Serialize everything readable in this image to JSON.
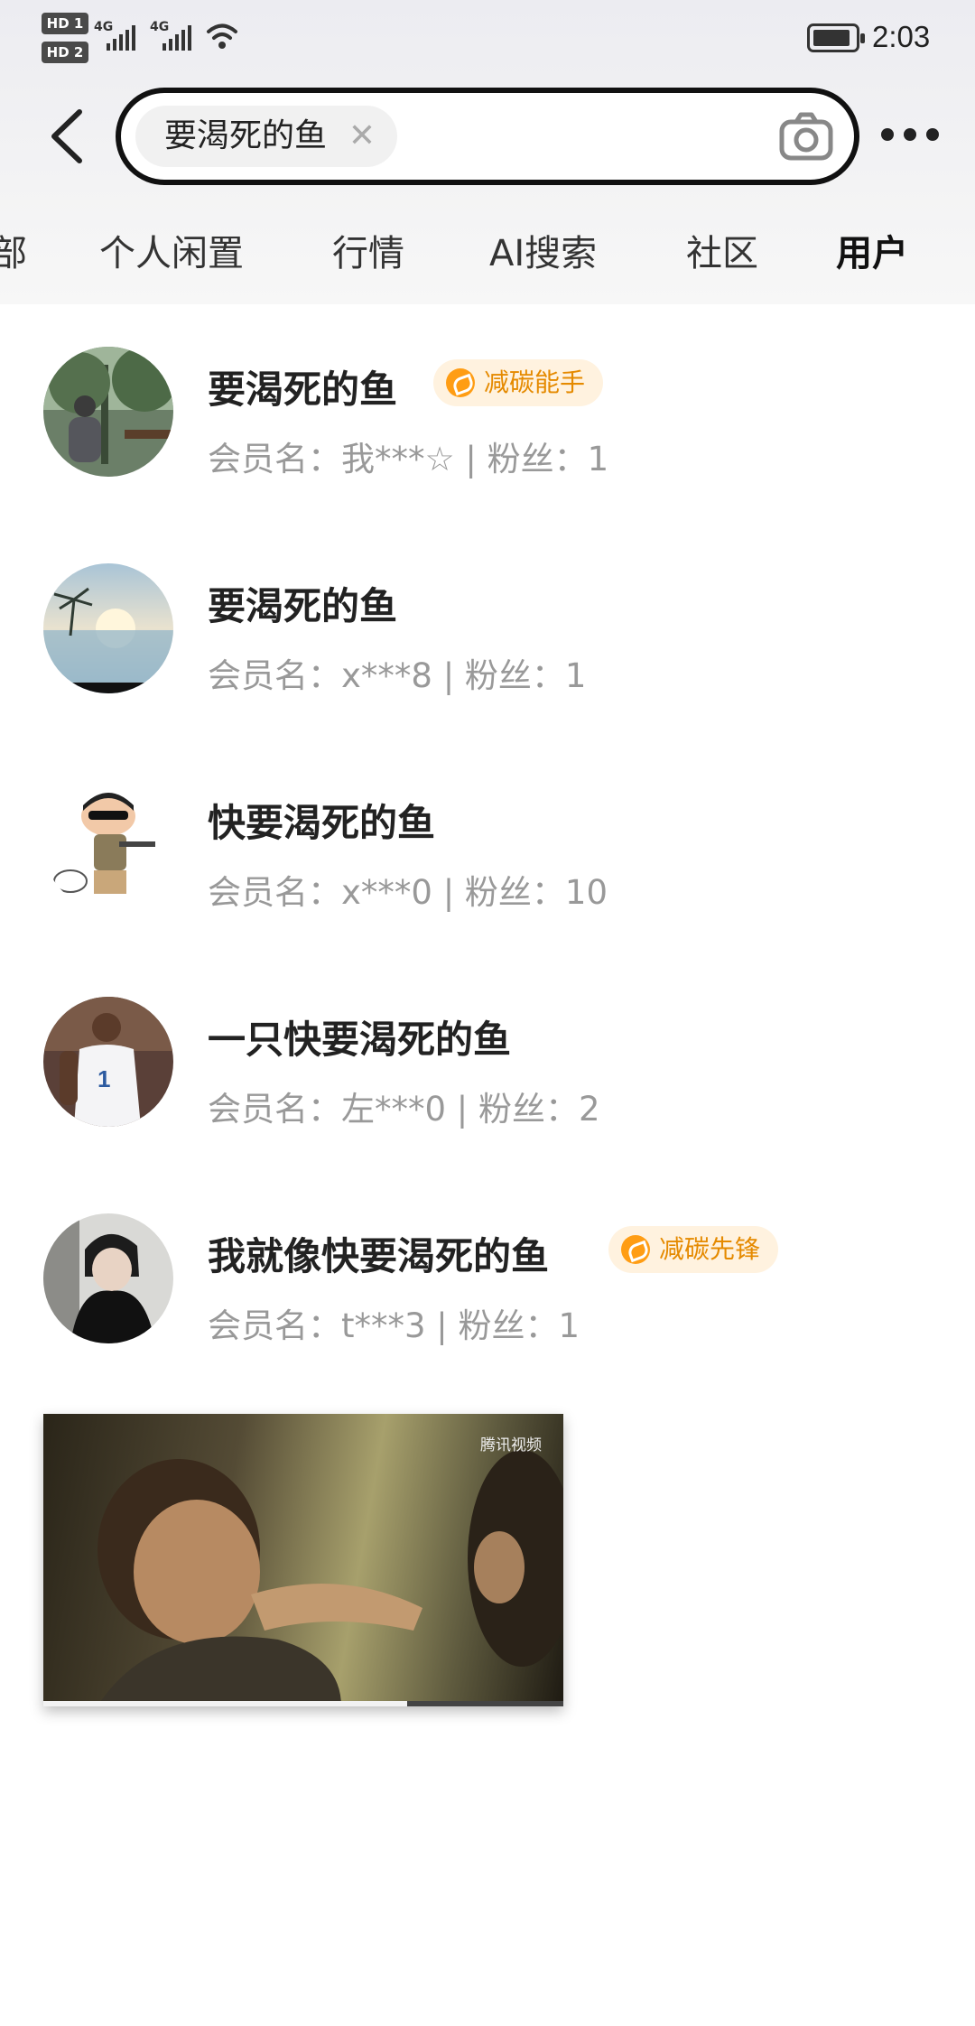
{
  "status_bar": {
    "sim1_label": "HD 1",
    "sim2_label": "HD 2",
    "network1": "4G",
    "network2": "4G",
    "time": "2:03"
  },
  "search": {
    "query": "要渴死的鱼",
    "icons": [
      "back-arrow-icon",
      "clear-icon",
      "camera-icon",
      "more-icon"
    ]
  },
  "tabs": [
    {
      "label": "部"
    },
    {
      "label": "个人闲置"
    },
    {
      "label": "行情"
    },
    {
      "label": "AI搜索"
    },
    {
      "label": "社区"
    },
    {
      "label": "用户",
      "active": true
    }
  ],
  "users": [
    {
      "name": "要渴死的鱼",
      "meta": "会员名：我***☆ | 粉丝：1",
      "badge": "减碳能手"
    },
    {
      "name": "要渴死的鱼",
      "meta": "会员名：x***8 | 粉丝：1",
      "badge": ""
    },
    {
      "name": "快要渴死的鱼",
      "meta": "会员名：x***0 | 粉丝：10",
      "badge": ""
    },
    {
      "name": "一只快要渴死的鱼",
      "meta": "会员名：左***0 | 粉丝：2",
      "badge": ""
    },
    {
      "name": "我就像快要渴死的鱼",
      "meta": "会员名：t***3 | 粉丝：1",
      "badge": "减碳先锋"
    }
  ],
  "video": {
    "watermark": "腾讯视频",
    "progress": 0.7
  },
  "colors": {
    "accent_yellow": "#ffe500",
    "badge_orange": "#e58a00",
    "badge_bg": "#fff2df"
  }
}
